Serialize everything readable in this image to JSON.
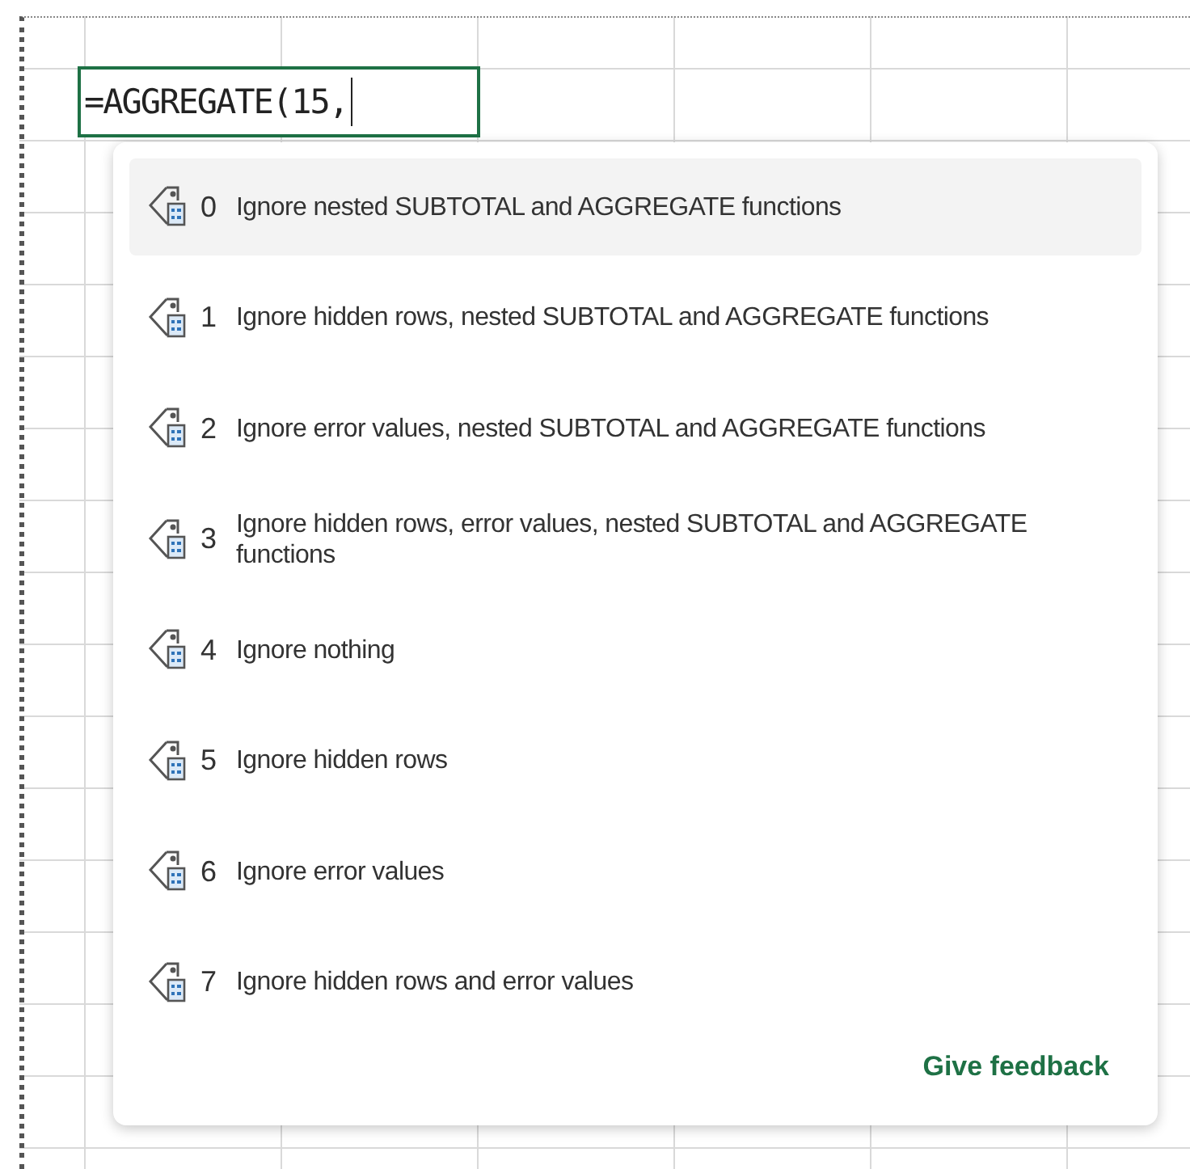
{
  "cell_editor": {
    "value": "=AGGREGATE(15,"
  },
  "suggestions": [
    {
      "number": "0",
      "description": "Ignore nested SUBTOTAL and AGGREGATE functions",
      "selected": true
    },
    {
      "number": "1",
      "description": "Ignore hidden rows, nested SUBTOTAL and AGGREGATE functions",
      "selected": false
    },
    {
      "number": "2",
      "description": "Ignore error values, nested SUBTOTAL and AGGREGATE functions",
      "selected": false
    },
    {
      "number": "3",
      "description": "Ignore hidden rows, error values, nested SUBTOTAL and AGGREGATE functions",
      "selected": false
    },
    {
      "number": "4",
      "description": "Ignore nothing",
      "selected": false
    },
    {
      "number": "5",
      "description": "Ignore hidden rows",
      "selected": false
    },
    {
      "number": "6",
      "description": "Ignore error values",
      "selected": false
    },
    {
      "number": "7",
      "description": "Ignore hidden rows and error values",
      "selected": false
    }
  ],
  "feedback_link": "Give feedback"
}
